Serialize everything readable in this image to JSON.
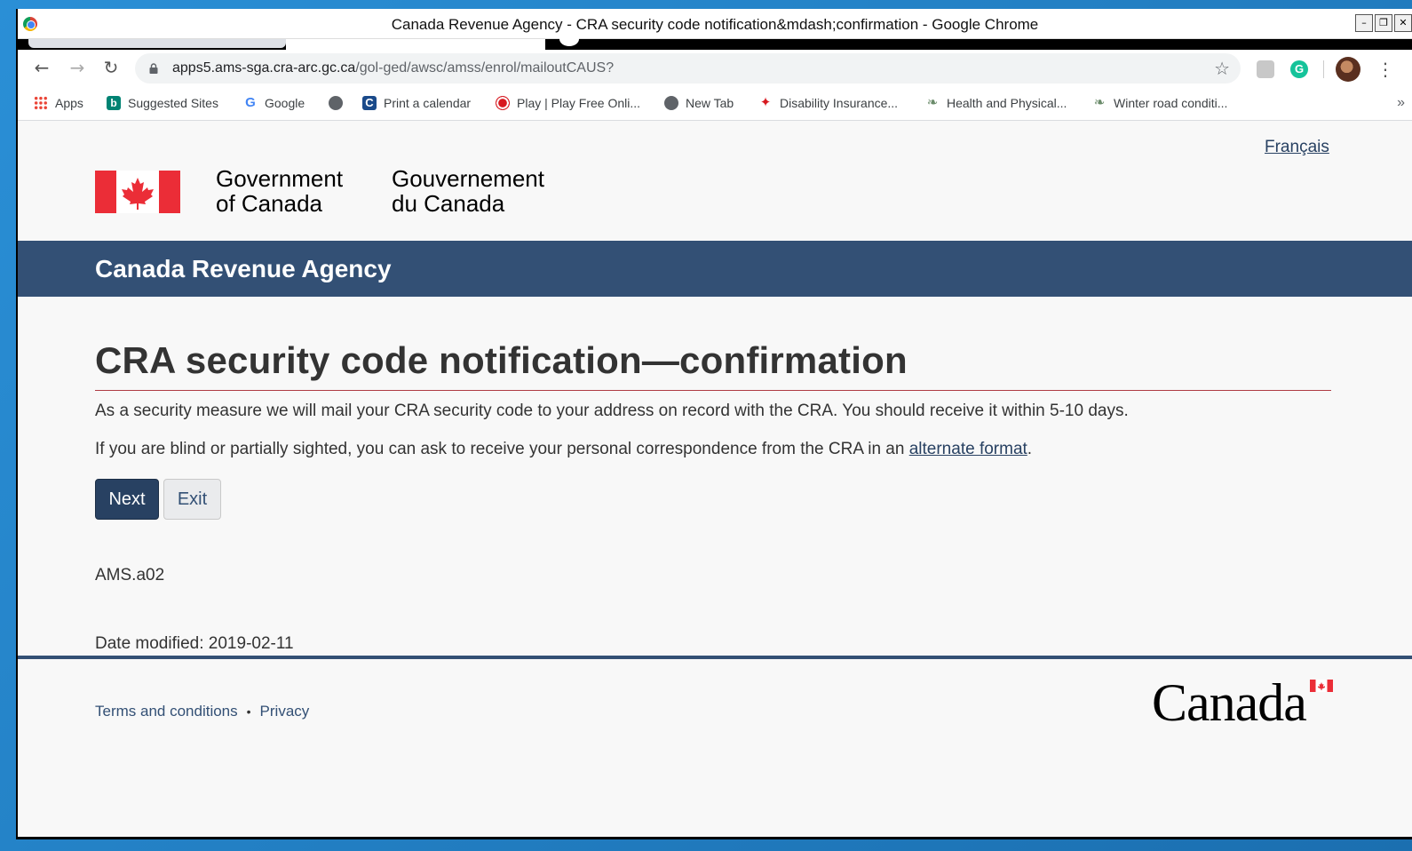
{
  "window": {
    "title": "Canada Revenue Agency - CRA security code notification&mdash;confirmation - Google Chrome",
    "controls": [
      "–",
      "❐",
      "✕"
    ]
  },
  "toolbar": {
    "url_host": "apps5.ams-sga.cra-arc.gc.ca",
    "url_path": "/gol-ged/awsc/amss/enrol/mailoutCAUS?",
    "ext_grammarly": "G"
  },
  "bookmarks": [
    {
      "label": "Apps",
      "icon": "apps-grid-icon"
    },
    {
      "label": "Suggested Sites",
      "icon": "bing-icon"
    },
    {
      "label": "Google",
      "icon": "google-icon"
    },
    {
      "label": "",
      "icon": "globe-icon"
    },
    {
      "label": "Print a calendar",
      "icon": "calendar-icon"
    },
    {
      "label": "Play | Play Free Onli...",
      "icon": "cbc-icon"
    },
    {
      "label": "New Tab",
      "icon": "globe-icon"
    },
    {
      "label": "Disability Insurance...",
      "icon": "maple-leaf-icon"
    },
    {
      "label": "Health and Physical...",
      "icon": "vine-icon"
    },
    {
      "label": "Winter road conditi...",
      "icon": "vine-icon"
    }
  ],
  "page": {
    "lang_toggle": "Français",
    "gov_en_line1": "Government",
    "gov_en_line2": "of Canada",
    "gov_fr_line1": "Gouvernement",
    "gov_fr_line2": "du Canada",
    "agency_name": "Canada Revenue Agency",
    "title": "CRA security code notification—confirmation",
    "paragraph1": "As a security measure we will mail your CRA security code to your address on record with the CRA. You should receive it within 5-10 days.",
    "paragraph2_prefix": "If you are blind or partially sighted, you can ask to receive your personal correspondence from the CRA in an ",
    "paragraph2_link": "alternate format",
    "paragraph2_suffix": ".",
    "next_button": "Next",
    "exit_button": "Exit",
    "page_id": "AMS.a02",
    "date_modified_label": "Date modified: ",
    "date_modified_value": "2019-02-11"
  },
  "footer": {
    "terms": "Terms and conditions",
    "separator": "•",
    "privacy": "Privacy",
    "wordmark": "Canada"
  },
  "colors": {
    "agency_bar": "#335075",
    "title_rule": "#af3c43",
    "primary_button": "#284162",
    "flag_red": "#eb2d37"
  }
}
